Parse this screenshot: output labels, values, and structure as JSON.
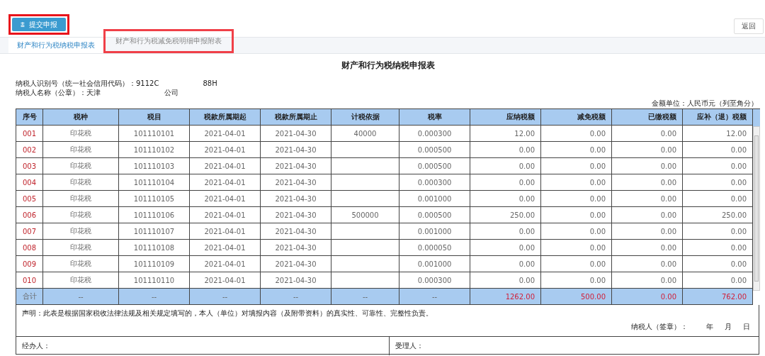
{
  "toolbar": {
    "submit_button": {
      "icon": "⩲",
      "label": "提交申报"
    },
    "back_button": "返回"
  },
  "tabs": [
    {
      "label": "财产和行为税纳税申报表",
      "selected": true
    },
    {
      "label": "财产和行为税减免税明细申报附表",
      "selected": false
    }
  ],
  "form": {
    "title": "财产和行为税纳税申报表",
    "taxpayer_id": {
      "label": "纳税人识别号（统一社会信用代码）：9112C",
      "tail": "88H"
    },
    "taxpayer_name": {
      "label": "纳税人名称（公章）：天津",
      "tail": "公司"
    },
    "unit": "金额单位：人民币元（列至角分）"
  },
  "table": {
    "columns": [
      "序号",
      "税种",
      "税目",
      "税款所属期起",
      "税款所属期止",
      "计税依据",
      "税率",
      "应纳税额",
      "减免税额",
      "已缴税额",
      "应补（退）税额"
    ],
    "rows": [
      [
        "001",
        "印花税",
        "101110101",
        "2021-04-01",
        "2021-04-30",
        "40000",
        "0.000300",
        "12.00",
        "0.00",
        "0.00",
        "12.00"
      ],
      [
        "002",
        "印花税",
        "101110102",
        "2021-04-01",
        "2021-04-30",
        "",
        "0.000500",
        "0.00",
        "0.00",
        "0.00",
        "0.00"
      ],
      [
        "003",
        "印花税",
        "101110103",
        "2021-04-01",
        "2021-04-30",
        "",
        "0.000500",
        "0.00",
        "0.00",
        "0.00",
        "0.00"
      ],
      [
        "004",
        "印花税",
        "101110104",
        "2021-04-01",
        "2021-04-30",
        "",
        "0.000300",
        "0.00",
        "0.00",
        "0.00",
        "0.00"
      ],
      [
        "005",
        "印花税",
        "101110105",
        "2021-04-01",
        "2021-04-30",
        "",
        "0.001000",
        "0.00",
        "0.00",
        "0.00",
        "0.00"
      ],
      [
        "006",
        "印花税",
        "101110106",
        "2021-04-01",
        "2021-04-30",
        "500000",
        "0.000500",
        "250.00",
        "0.00",
        "0.00",
        "250.00"
      ],
      [
        "007",
        "印花税",
        "101110107",
        "2021-04-01",
        "2021-04-30",
        "",
        "0.001000",
        "0.00",
        "0.00",
        "0.00",
        "0.00"
      ],
      [
        "008",
        "印花税",
        "101110108",
        "2021-04-01",
        "2021-04-30",
        "",
        "0.000050",
        "0.00",
        "0.00",
        "0.00",
        "0.00"
      ],
      [
        "009",
        "印花税",
        "101110109",
        "2021-04-01",
        "2021-04-30",
        "",
        "0.001000",
        "0.00",
        "0.00",
        "0.00",
        "0.00"
      ],
      [
        "010",
        "印花税",
        "101110110",
        "2021-04-01",
        "2021-04-30",
        "",
        "0.000300",
        "0.00",
        "0.00",
        "0.00",
        "0.00"
      ]
    ],
    "total_row": [
      "合计",
      "--",
      "--",
      "--",
      "--",
      "--",
      "--",
      "1262.00",
      "500.00",
      "0.00",
      "762.00"
    ]
  },
  "declaration": "声明：此表是根据国家税收法律法规及相关规定填写的，本人（单位）对填报内容（及附带资料）的真实性、可靠性、完整性负责。",
  "signature": {
    "label": "纳税人（签章）：",
    "year": "年",
    "month": "月",
    "day": "日"
  },
  "footer": {
    "handler": "经办人：",
    "receiver": "受理人："
  }
}
